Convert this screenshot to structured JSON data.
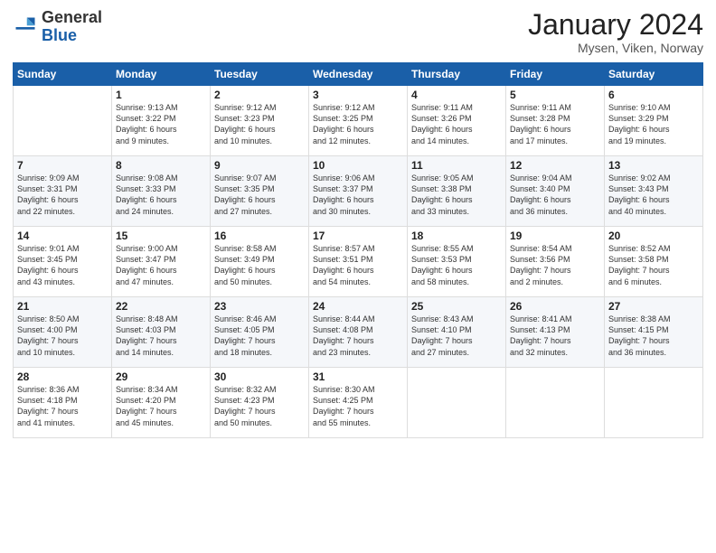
{
  "header": {
    "logo_general": "General",
    "logo_blue": "Blue",
    "month_title": "January 2024",
    "location": "Mysen, Viken, Norway"
  },
  "days_of_week": [
    "Sunday",
    "Monday",
    "Tuesday",
    "Wednesday",
    "Thursday",
    "Friday",
    "Saturday"
  ],
  "weeks": [
    [
      {
        "num": "",
        "info": ""
      },
      {
        "num": "1",
        "info": "Sunrise: 9:13 AM\nSunset: 3:22 PM\nDaylight: 6 hours\nand 9 minutes."
      },
      {
        "num": "2",
        "info": "Sunrise: 9:12 AM\nSunset: 3:23 PM\nDaylight: 6 hours\nand 10 minutes."
      },
      {
        "num": "3",
        "info": "Sunrise: 9:12 AM\nSunset: 3:25 PM\nDaylight: 6 hours\nand 12 minutes."
      },
      {
        "num": "4",
        "info": "Sunrise: 9:11 AM\nSunset: 3:26 PM\nDaylight: 6 hours\nand 14 minutes."
      },
      {
        "num": "5",
        "info": "Sunrise: 9:11 AM\nSunset: 3:28 PM\nDaylight: 6 hours\nand 17 minutes."
      },
      {
        "num": "6",
        "info": "Sunrise: 9:10 AM\nSunset: 3:29 PM\nDaylight: 6 hours\nand 19 minutes."
      }
    ],
    [
      {
        "num": "7",
        "info": "Sunrise: 9:09 AM\nSunset: 3:31 PM\nDaylight: 6 hours\nand 22 minutes."
      },
      {
        "num": "8",
        "info": "Sunrise: 9:08 AM\nSunset: 3:33 PM\nDaylight: 6 hours\nand 24 minutes."
      },
      {
        "num": "9",
        "info": "Sunrise: 9:07 AM\nSunset: 3:35 PM\nDaylight: 6 hours\nand 27 minutes."
      },
      {
        "num": "10",
        "info": "Sunrise: 9:06 AM\nSunset: 3:37 PM\nDaylight: 6 hours\nand 30 minutes."
      },
      {
        "num": "11",
        "info": "Sunrise: 9:05 AM\nSunset: 3:38 PM\nDaylight: 6 hours\nand 33 minutes."
      },
      {
        "num": "12",
        "info": "Sunrise: 9:04 AM\nSunset: 3:40 PM\nDaylight: 6 hours\nand 36 minutes."
      },
      {
        "num": "13",
        "info": "Sunrise: 9:02 AM\nSunset: 3:43 PM\nDaylight: 6 hours\nand 40 minutes."
      }
    ],
    [
      {
        "num": "14",
        "info": "Sunrise: 9:01 AM\nSunset: 3:45 PM\nDaylight: 6 hours\nand 43 minutes."
      },
      {
        "num": "15",
        "info": "Sunrise: 9:00 AM\nSunset: 3:47 PM\nDaylight: 6 hours\nand 47 minutes."
      },
      {
        "num": "16",
        "info": "Sunrise: 8:58 AM\nSunset: 3:49 PM\nDaylight: 6 hours\nand 50 minutes."
      },
      {
        "num": "17",
        "info": "Sunrise: 8:57 AM\nSunset: 3:51 PM\nDaylight: 6 hours\nand 54 minutes."
      },
      {
        "num": "18",
        "info": "Sunrise: 8:55 AM\nSunset: 3:53 PM\nDaylight: 6 hours\nand 58 minutes."
      },
      {
        "num": "19",
        "info": "Sunrise: 8:54 AM\nSunset: 3:56 PM\nDaylight: 7 hours\nand 2 minutes."
      },
      {
        "num": "20",
        "info": "Sunrise: 8:52 AM\nSunset: 3:58 PM\nDaylight: 7 hours\nand 6 minutes."
      }
    ],
    [
      {
        "num": "21",
        "info": "Sunrise: 8:50 AM\nSunset: 4:00 PM\nDaylight: 7 hours\nand 10 minutes."
      },
      {
        "num": "22",
        "info": "Sunrise: 8:48 AM\nSunset: 4:03 PM\nDaylight: 7 hours\nand 14 minutes."
      },
      {
        "num": "23",
        "info": "Sunrise: 8:46 AM\nSunset: 4:05 PM\nDaylight: 7 hours\nand 18 minutes."
      },
      {
        "num": "24",
        "info": "Sunrise: 8:44 AM\nSunset: 4:08 PM\nDaylight: 7 hours\nand 23 minutes."
      },
      {
        "num": "25",
        "info": "Sunrise: 8:43 AM\nSunset: 4:10 PM\nDaylight: 7 hours\nand 27 minutes."
      },
      {
        "num": "26",
        "info": "Sunrise: 8:41 AM\nSunset: 4:13 PM\nDaylight: 7 hours\nand 32 minutes."
      },
      {
        "num": "27",
        "info": "Sunrise: 8:38 AM\nSunset: 4:15 PM\nDaylight: 7 hours\nand 36 minutes."
      }
    ],
    [
      {
        "num": "28",
        "info": "Sunrise: 8:36 AM\nSunset: 4:18 PM\nDaylight: 7 hours\nand 41 minutes."
      },
      {
        "num": "29",
        "info": "Sunrise: 8:34 AM\nSunset: 4:20 PM\nDaylight: 7 hours\nand 45 minutes."
      },
      {
        "num": "30",
        "info": "Sunrise: 8:32 AM\nSunset: 4:23 PM\nDaylight: 7 hours\nand 50 minutes."
      },
      {
        "num": "31",
        "info": "Sunrise: 8:30 AM\nSunset: 4:25 PM\nDaylight: 7 hours\nand 55 minutes."
      },
      {
        "num": "",
        "info": ""
      },
      {
        "num": "",
        "info": ""
      },
      {
        "num": "",
        "info": ""
      }
    ]
  ]
}
